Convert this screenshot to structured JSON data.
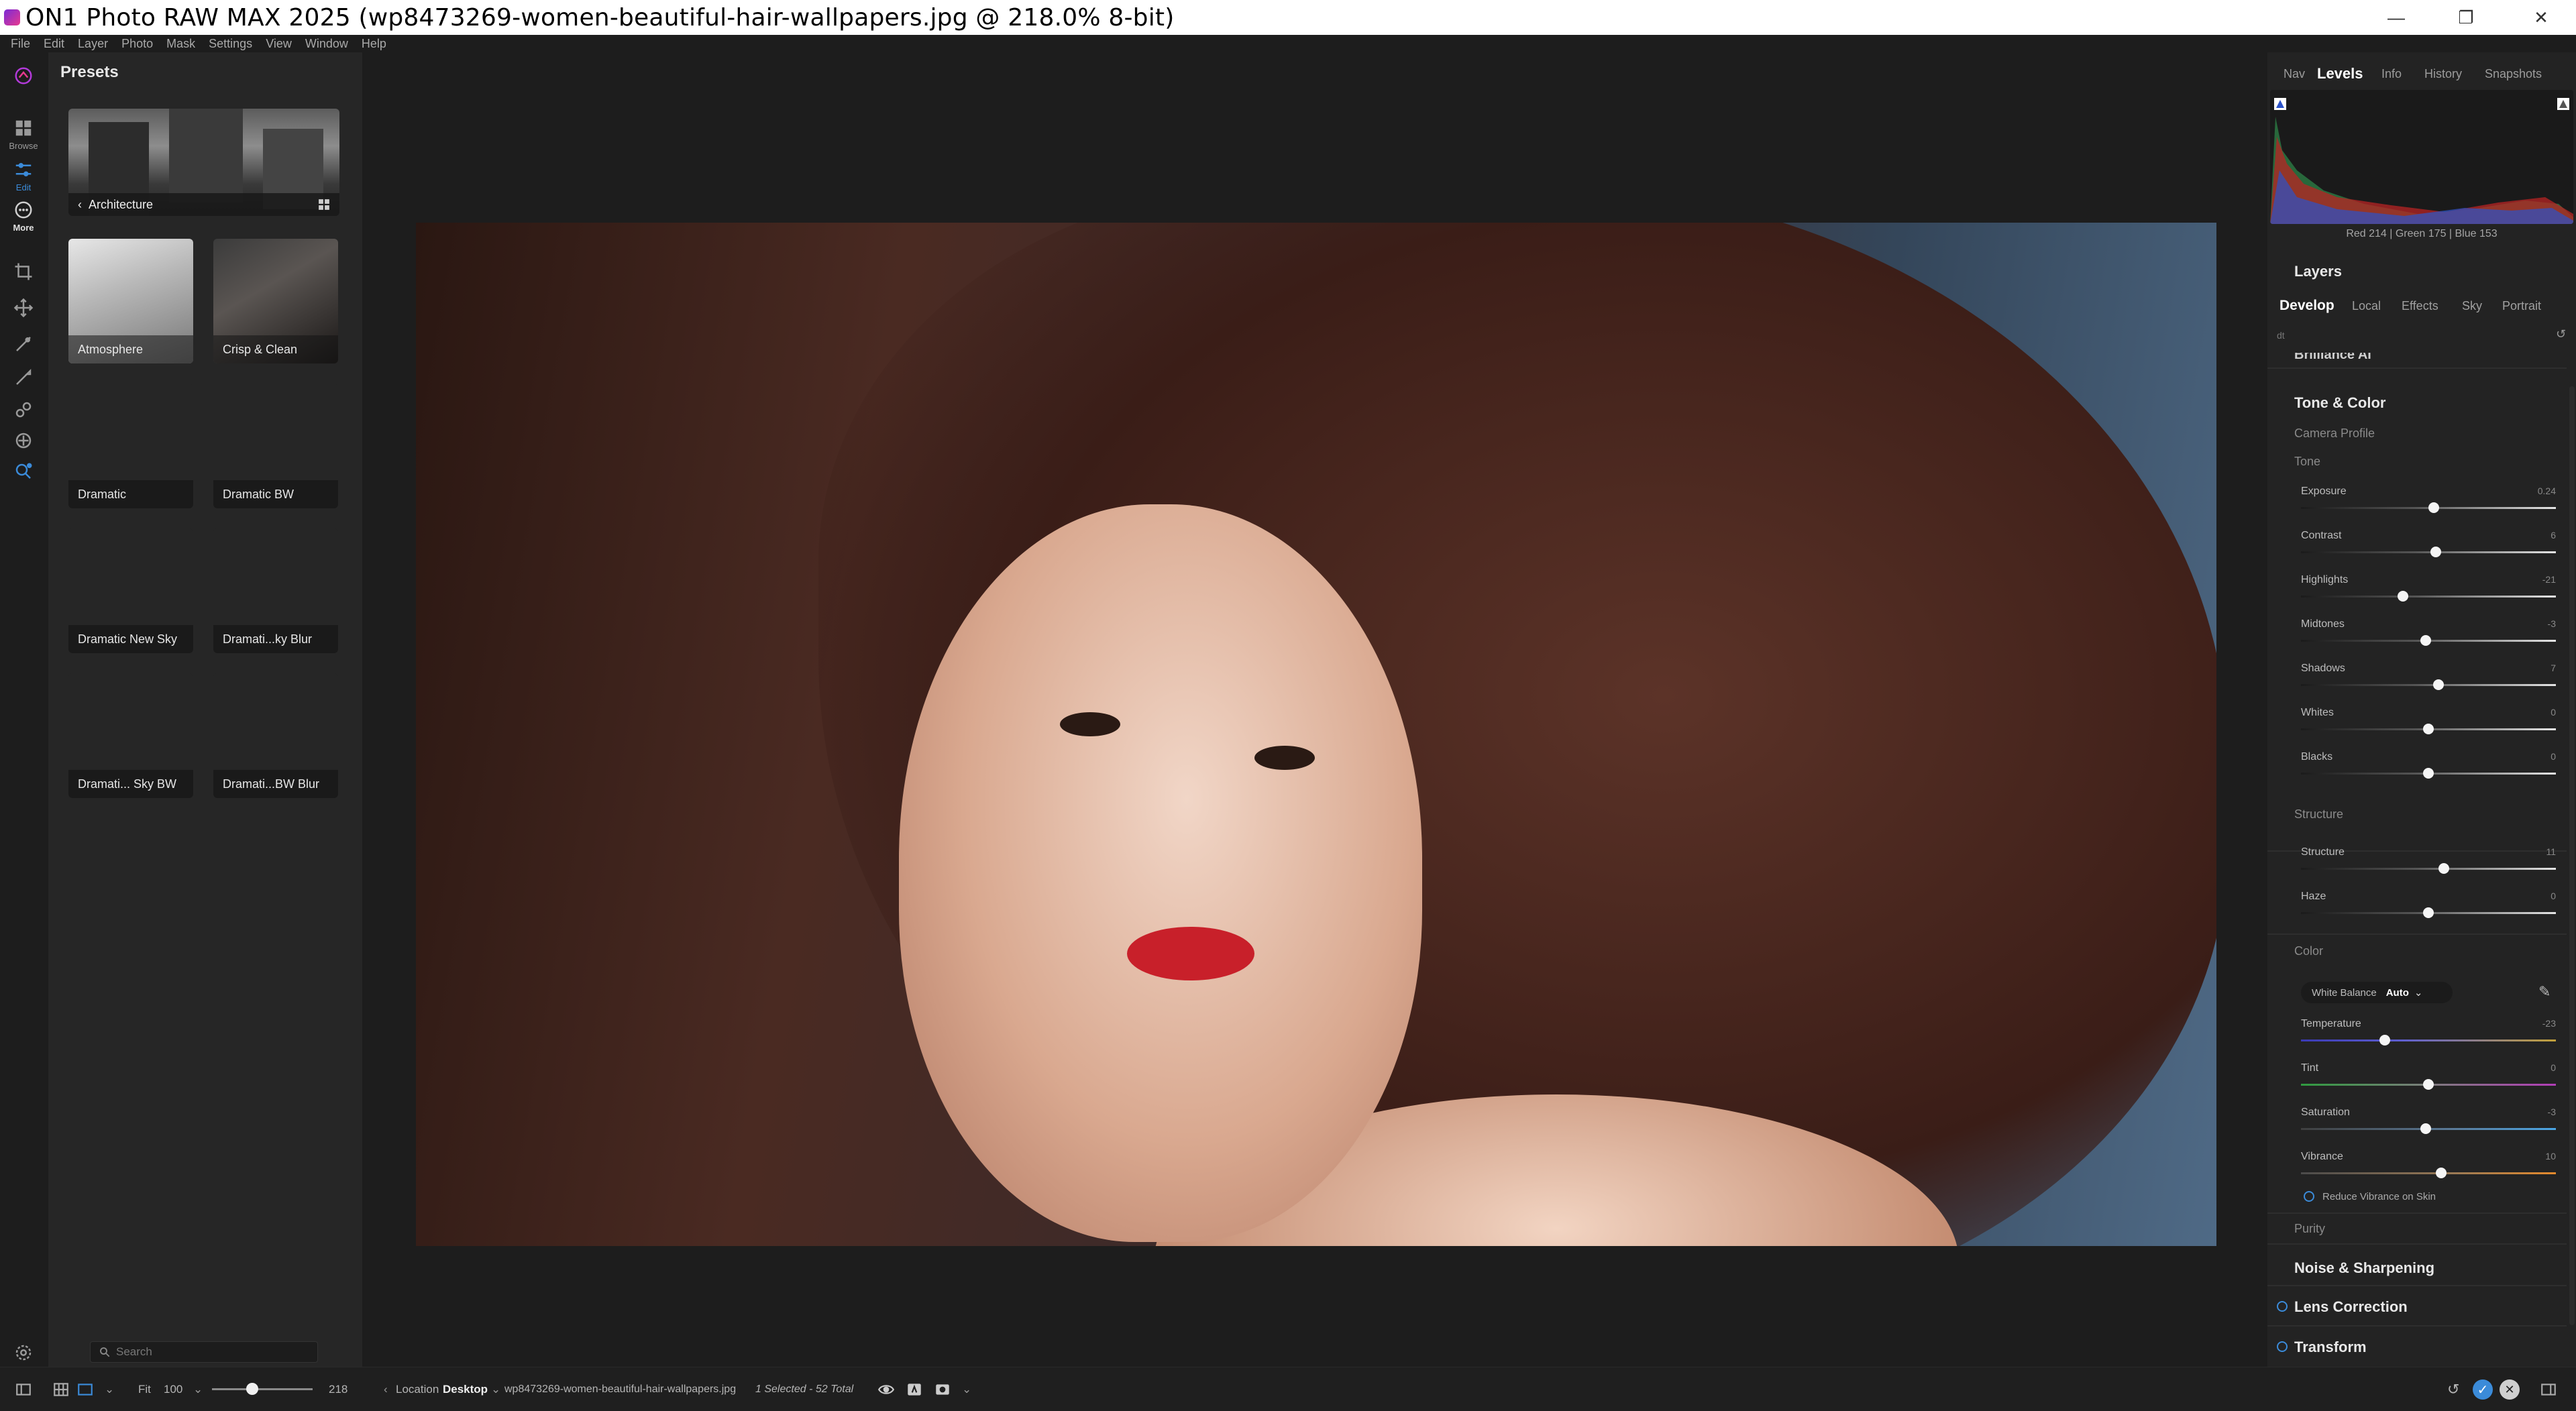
{
  "window": {
    "title": "ON1 Photo RAW MAX 2025 (wp8473269-women-beautiful-hair-wallpapers.jpg @ 218.0% 8-bit)",
    "controls": [
      "—",
      "❐",
      "✕"
    ]
  },
  "menu": [
    "File",
    "Edit",
    "Layer",
    "Photo",
    "Mask",
    "Settings",
    "View",
    "Window",
    "Help"
  ],
  "modules": {
    "browse": "Browse",
    "edit": "Edit",
    "more": "More"
  },
  "presets": {
    "title": "Presets",
    "category": "Architecture",
    "items": [
      {
        "label": "Atmosphere"
      },
      {
        "label": "Crisp & Clean"
      },
      {
        "label": "Dramatic"
      },
      {
        "label": "Dramatic BW"
      },
      {
        "label": "Dramatic New Sky"
      },
      {
        "label": "Dramati...ky Blur"
      },
      {
        "label": "Dramati... Sky BW"
      },
      {
        "label": "Dramati...BW Blur"
      }
    ],
    "search_placeholder": "Search"
  },
  "right_panel": {
    "tabs": [
      "Nav",
      "Levels",
      "Info",
      "History",
      "Snapshots"
    ],
    "active_tab": "Levels",
    "histogram_readout": "Red 214 | Green 175 | Blue 153",
    "layers_title": "Layers",
    "subtabs": [
      "Develop",
      "Local",
      "Effects",
      "Sky",
      "Portrait"
    ],
    "active_subtab": "Develop",
    "filter_hint": "dt",
    "truncated_section": "Brilliance AI",
    "tone_color_title": "Tone & Color",
    "camera_profile": "Camera Profile",
    "tone_label": "Tone",
    "tone_sliders": [
      {
        "name": "Exposure",
        "value": "0.24",
        "pos": 0.52
      },
      {
        "name": "Contrast",
        "value": "6",
        "pos": 0.53
      },
      {
        "name": "Highlights",
        "value": "-21",
        "pos": 0.4
      },
      {
        "name": "Midtones",
        "value": "-3",
        "pos": 0.49
      },
      {
        "name": "Shadows",
        "value": "7",
        "pos": 0.54
      },
      {
        "name": "Whites",
        "value": "0",
        "pos": 0.5
      },
      {
        "name": "Blacks",
        "value": "0",
        "pos": 0.5
      }
    ],
    "structure_label": "Structure",
    "structure_sliders": [
      {
        "name": "Structure",
        "value": "11",
        "pos": 0.56
      },
      {
        "name": "Haze",
        "value": "0",
        "pos": 0.5
      }
    ],
    "color_label": "Color",
    "white_balance_label": "White Balance",
    "white_balance_value": "Auto",
    "color_sliders": [
      {
        "name": "Temperature",
        "value": "-23",
        "pos": 0.33,
        "kind": "temp"
      },
      {
        "name": "Tint",
        "value": "0",
        "pos": 0.5,
        "kind": "tint"
      },
      {
        "name": "Saturation",
        "value": "-3",
        "pos": 0.49,
        "kind": "sat"
      },
      {
        "name": "Vibrance",
        "value": "10",
        "pos": 0.55,
        "kind": "vib"
      }
    ],
    "reduce_vibrance": "Reduce Vibrance on Skin",
    "purity_label": "Purity",
    "noise_sharpening": "Noise & Sharpening",
    "lens_correction": "Lens Correction",
    "transform": "Transform"
  },
  "bottom": {
    "fit": "Fit",
    "zoom_value": "100",
    "zoom_max": "218",
    "zoom_level": 0.4,
    "location_label": "Location",
    "location_value": "Desktop",
    "filename": "wp8473269-women-beautiful-hair-wallpapers.jpg",
    "selection": "1 Selected - 52 Total"
  },
  "colors": {
    "accent": "#3b8bd9",
    "bg": "#1d1d1d",
    "panel": "#262626"
  }
}
